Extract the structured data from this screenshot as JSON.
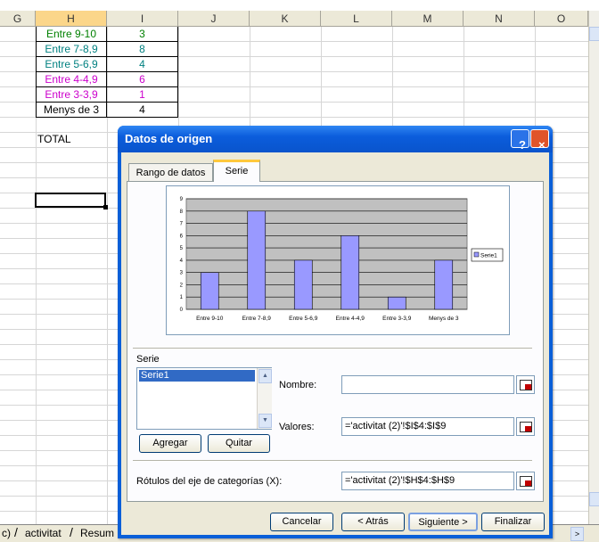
{
  "columns": [
    "G",
    "H",
    "I",
    "J",
    "K",
    "L",
    "M",
    "N",
    "O"
  ],
  "table_rows": [
    {
      "label": "Entre 9-10",
      "value": "3",
      "color": "#008000"
    },
    {
      "label": "Entre 7-8,9",
      "value": "8",
      "color": "#008080"
    },
    {
      "label": "Entre 5-6,9",
      "value": "4",
      "color": "#008080"
    },
    {
      "label": "Entre 4-4,9",
      "value": "6",
      "color": "#cc00cc"
    },
    {
      "label": "Entre 3-3,9",
      "value": "1",
      "color": "#cc00cc"
    },
    {
      "label": "Menys de 3",
      "value": "4",
      "color": "#000000"
    }
  ],
  "total_label": "TOTAL",
  "sheet_tabs": {
    "partial": "c)",
    "tab1": "activitat",
    "tab2": "Resum"
  },
  "dialog": {
    "title": "Datos de origen",
    "help_icon": "?",
    "close_icon": "×",
    "tab_range": "Rango de datos",
    "tab_series": "Serie",
    "series_section_label": "Serie",
    "series_list": [
      "Serie1"
    ],
    "add_button": "Agregar",
    "remove_button": "Quitar",
    "name_label": "Nombre:",
    "name_value": "",
    "values_label": "Valores:",
    "values_value": "='activitat (2)'!$I$4:$I$9",
    "category_label": "Rótulos del eje de categorías (X):",
    "category_value": "='activitat (2)'!$H$4:$H$9",
    "cancel_button": "Cancelar",
    "back_button": "< Atrás",
    "next_button": "Siguiente >",
    "finish_button": "Finalizar"
  },
  "chart_data": {
    "type": "bar",
    "categories": [
      "Entre 9-10",
      "Entre 7-8,9",
      "Entre 5-6,9",
      "Entre 4-4,9",
      "Entre 3-3,9",
      "Menys de 3"
    ],
    "series": [
      {
        "name": "Serie1",
        "values": [
          3,
          8,
          4,
          6,
          1,
          4
        ],
        "color": "#9999ff"
      }
    ],
    "ylim": [
      0,
      9
    ],
    "yticks": [
      "0",
      "1",
      "2",
      "3",
      "4",
      "5",
      "6",
      "7",
      "8",
      "9"
    ],
    "legend": "right",
    "grid": true,
    "plot_background": "#c0c0c0"
  }
}
